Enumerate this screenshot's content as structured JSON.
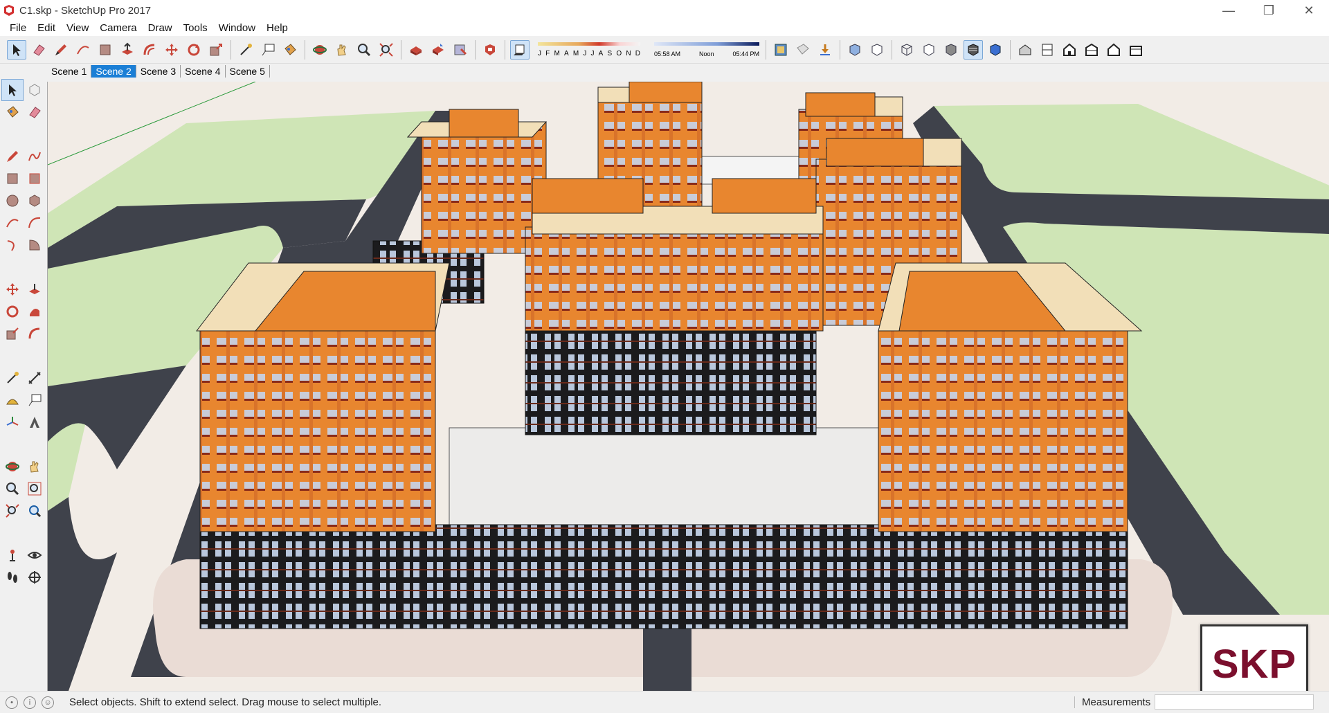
{
  "window": {
    "title": "C1.skp - SketchUp Pro 2017",
    "minimize_glyph": "—",
    "maximize_glyph": "❐",
    "close_glyph": "✕"
  },
  "menu": [
    "File",
    "Edit",
    "View",
    "Camera",
    "Draw",
    "Tools",
    "Window",
    "Help"
  ],
  "shadow_panel": {
    "months": [
      "J",
      "F",
      "M",
      "A",
      "M",
      "J",
      "J",
      "A",
      "S",
      "O",
      "N",
      "D"
    ],
    "time_start": "05:58 AM",
    "time_mid": "Noon",
    "time_end": "05:44 PM"
  },
  "scenes": [
    {
      "label": "Scene 1",
      "active": false
    },
    {
      "label": "Scene 2",
      "active": true
    },
    {
      "label": "Scene 3",
      "active": false
    },
    {
      "label": "Scene 4",
      "active": false
    },
    {
      "label": "Scene 5",
      "active": false
    }
  ],
  "status": {
    "message": "Select objects. Shift to extend select. Drag mouse to select multiple.",
    "measurements_label": "Measurements",
    "measurements_value": ""
  },
  "watermark": "SKP",
  "colors": {
    "accent": "#1b7fd6",
    "ground": "#f2ece6",
    "lawn": "#cfe5b6",
    "road": "#3f424b",
    "facade_orange": "#e8862f",
    "roof_cream": "#f2dfb8",
    "podium_dark": "#1b1b1d",
    "glass": "#b9c7dc"
  }
}
